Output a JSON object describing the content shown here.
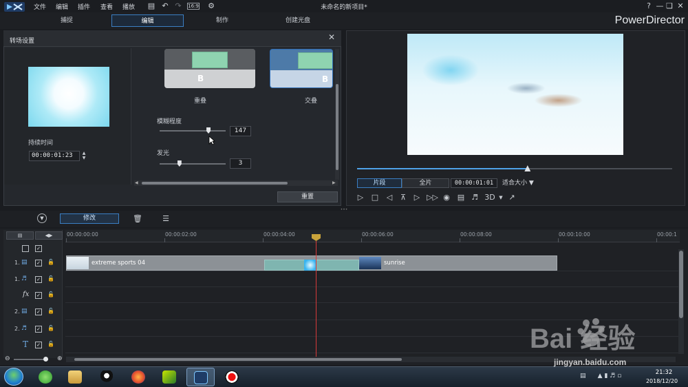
{
  "menu": [
    "文件",
    "编辑",
    "插件",
    "查看",
    "播放"
  ],
  "window": {
    "title": "未命名的新项目*",
    "help": "?"
  },
  "modes": [
    "捕捉",
    "编辑",
    "制作",
    "创建光盘"
  ],
  "brand": "PowerDirector",
  "transition_panel": {
    "title": "转场设置",
    "duration_label": "持续时间",
    "duration_value": "00:00:01:23",
    "effects": [
      {
        "label": "重叠",
        "badge": "B"
      },
      {
        "label": "交叠",
        "badge": "B"
      }
    ],
    "blur": {
      "label": "模糊程度",
      "value": "147",
      "level_fraction": 0.74
    },
    "glow": {
      "label": "发光",
      "value": "3",
      "level_fraction": 0.3
    },
    "reset_label": "重置"
  },
  "player": {
    "clip_btn": "片段",
    "movie_btn": "全片",
    "timecode": "00:00:01:01",
    "fit": "适合大小",
    "three_d": "3D",
    "progress_fraction": 0.54
  },
  "edit_toolbar": {
    "modify_label": "修改"
  },
  "timeline": {
    "ruler": [
      "00:00:00:00",
      "00:00:02:00",
      "00:00:04:00",
      "00:00:06:00",
      "00:00:08:00",
      "00:00:10:00",
      "00:00:1"
    ],
    "tracks": [
      {
        "num": "1.",
        "type": "video"
      },
      {
        "num": "1.",
        "type": "audio"
      },
      {
        "num": "",
        "type": "fx"
      },
      {
        "num": "2.",
        "type": "video"
      },
      {
        "num": "2.",
        "type": "audio"
      },
      {
        "num": "",
        "type": "title"
      }
    ],
    "clips": [
      "extreme sports 04",
      "sunrise"
    ]
  },
  "taskbar": {
    "time": "21:32",
    "date": "2018/12/20"
  },
  "watermark": {
    "brand": "Bai  经验",
    "url": "jingyan.baidu.com"
  },
  "colors": {
    "accent": "#3b7fc4",
    "playhead": "#d83a3a",
    "clip": "#8c9196",
    "transition": "#7fb5b0"
  }
}
